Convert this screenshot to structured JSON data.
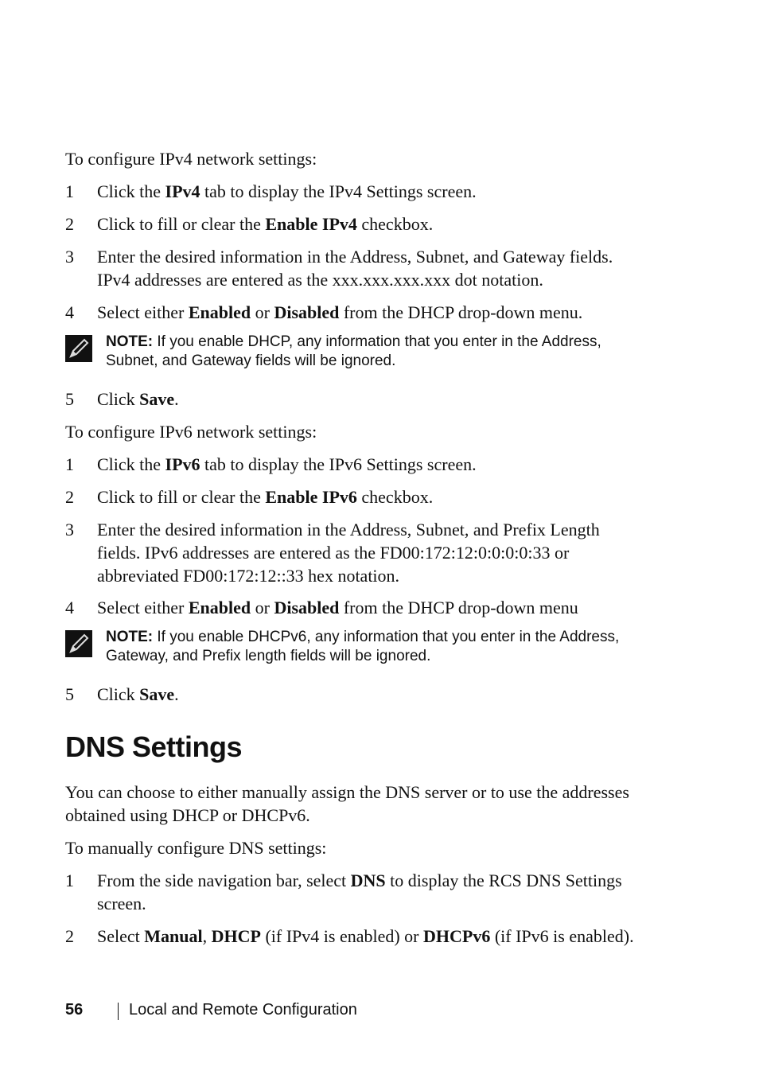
{
  "ipv4": {
    "intro": "To configure IPv4 network settings:",
    "steps": [
      {
        "num": "1",
        "pre": "Click the ",
        "bold": "IPv4",
        "post": " tab to display the IPv4 Settings screen."
      },
      {
        "num": "2",
        "pre": "Click to fill or clear the ",
        "bold": "Enable IPv4",
        "post": " checkbox."
      },
      {
        "num": "3",
        "line1": "Enter the desired information in the Address, Subnet, and Gateway fields.",
        "line2": "IPv4 addresses are entered as the xxx.xxx.xxx.xxx dot notation."
      },
      {
        "num": "4",
        "pre": "Select either ",
        "bold1": "Enabled",
        "mid": " or ",
        "bold2": "Disabled",
        "post": " from the DHCP drop-down menu."
      },
      {
        "num": "5",
        "pre": "Click ",
        "bold": "Save",
        "post": "."
      }
    ],
    "note": {
      "label": "NOTE:",
      "line1": " If you enable DHCP, any information that you enter in the Address,",
      "line2": "Subnet, and Gateway fields will be ignored."
    }
  },
  "ipv6": {
    "intro": "To configure IPv6 network settings:",
    "steps": [
      {
        "num": "1",
        "pre": "Click the ",
        "bold": "IPv6",
        "post": " tab to display the IPv6 Settings screen."
      },
      {
        "num": "2",
        "pre": "Click to fill or clear the ",
        "bold": "Enable IPv6",
        "post": " checkbox."
      },
      {
        "num": "3",
        "line1": "Enter the desired information in the Address, Subnet, and Prefix Length",
        "line2": "fields. IPv6 addresses are entered as the FD00:172:12:0:0:0:0:33 or",
        "line3": "abbreviated FD00:172:12::33 hex notation."
      },
      {
        "num": "4",
        "pre": "Select either ",
        "bold1": "Enabled",
        "mid": " or ",
        "bold2": "Disabled",
        "post": " from the DHCP drop-down menu"
      },
      {
        "num": "5",
        "pre": "Click ",
        "bold": "Save",
        "post": "."
      }
    ],
    "note": {
      "label": "NOTE:",
      "line1": " If you enable DHCPv6, any information that you enter in the Address,",
      "line2": "Gateway, and Prefix length fields will be ignored."
    }
  },
  "dns": {
    "heading": "DNS Settings",
    "para_line1": "You can choose to either manually assign the DNS server or to use the addresses",
    "para_line2": "obtained using DHCP or DHCPv6.",
    "intro": "To manually configure DNS settings:",
    "steps": [
      {
        "num": "1",
        "pre": "From the side navigation bar, select ",
        "bold": "DNS",
        "post": " to display the RCS DNS Settings",
        "line2": "screen."
      },
      {
        "num": "2",
        "pre": "Select ",
        "bold1": "Manual",
        "mid1": ", ",
        "bold2": "DHCP",
        "mid2": " (if IPv4 is enabled) or ",
        "bold3": "DHCPv6",
        "post": " (if IPv6 is enabled)."
      }
    ]
  },
  "footer": {
    "page_number": "56",
    "section_title": "Local and Remote Configuration"
  }
}
